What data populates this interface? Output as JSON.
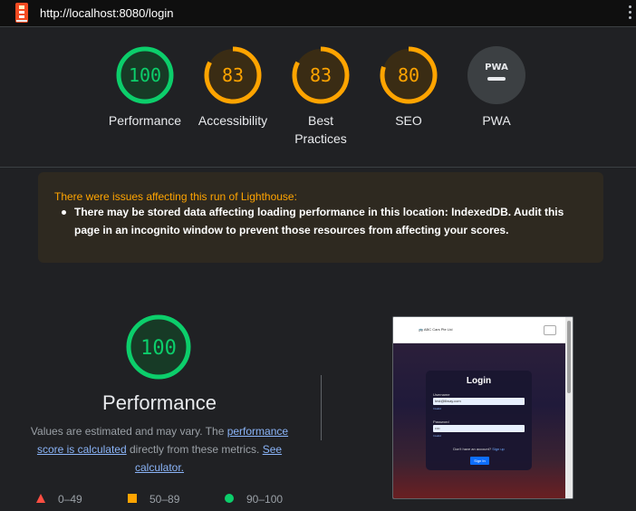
{
  "browser": {
    "url": "http://localhost:8080/login"
  },
  "colors": {
    "pass": "#0cce6b",
    "average": "#ffa400",
    "fail": "#ff4e42",
    "warning_text": "#ffa400",
    "link": "#8ab4f8"
  },
  "gauges": [
    {
      "score": "100",
      "label": "Performance",
      "fraction": 1.0,
      "color": "#0cce6b"
    },
    {
      "score": "83",
      "label": "Accessibility",
      "fraction": 0.83,
      "color": "#ffa400"
    },
    {
      "score": "83",
      "label": "Best Practices",
      "fraction": 0.83,
      "color": "#ffa400"
    },
    {
      "score": "80",
      "label": "SEO",
      "fraction": 0.8,
      "color": "#ffa400"
    },
    {
      "score": "",
      "label": "PWA",
      "badge": "PWA"
    }
  ],
  "warning": {
    "title": "There were issues affecting this run of Lighthouse:",
    "items": [
      "There may be stored data affecting loading performance in this location: IndexedDB. Audit this page in an incognito window to prevent those resources from affecting your scores."
    ]
  },
  "performance": {
    "score": "100",
    "fraction": 1.0,
    "title": "Performance",
    "desc_1": "Values are estimated and may vary. The ",
    "link_1": "performance score is calculated",
    "desc_2": " directly from these metrics. ",
    "link_2": "See calculator."
  },
  "legend": [
    {
      "range": "0–49",
      "icon": "fail-triangle-icon"
    },
    {
      "range": "50–89",
      "icon": "average-square-icon"
    },
    {
      "range": "90–100",
      "icon": "pass-circle-icon"
    }
  ],
  "screenshot": {
    "brand": "🚌 ABC Cars Pte Ltd",
    "title": "Login",
    "username_label": "Username",
    "username_value": "test@lilway.com",
    "password_label": "Password",
    "password_value": "••••",
    "small_text": "Invalid",
    "account_text": "Don't have an account?",
    "signup_link": "Sign up",
    "button": "Sign In"
  }
}
